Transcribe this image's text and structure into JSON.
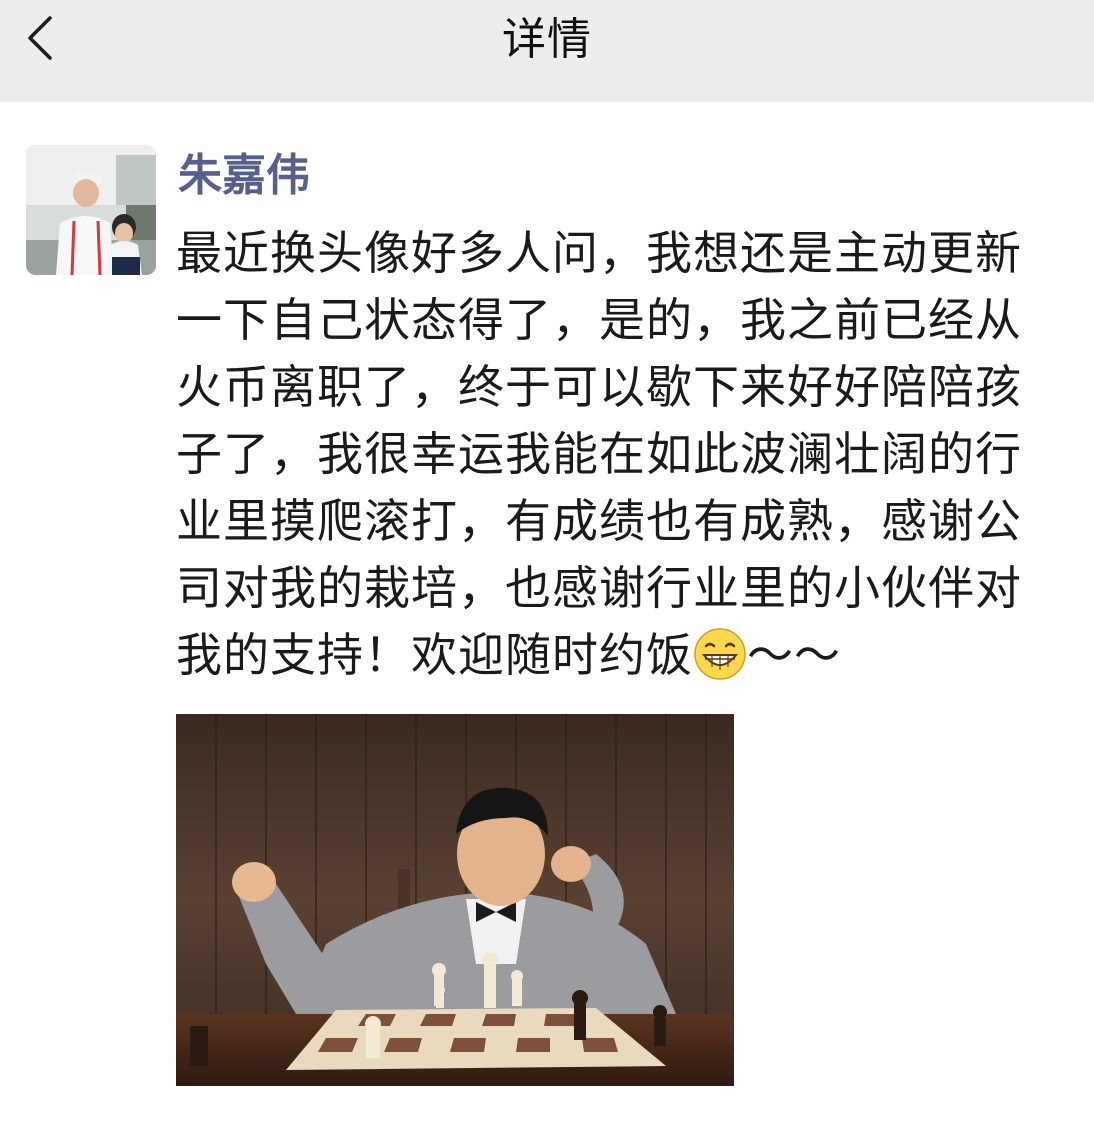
{
  "header": {
    "title": "详情",
    "back_icon": "chevron-left-icon"
  },
  "post": {
    "author": "朱嘉伟",
    "text": "最近换头像好多人问，我想还是主动更新一下自己状态得了，是的，我之前已经从火币离职了，终于可以歇下来好好陪陪孩子了，我很幸运我能在如此波澜壮阔的行业里摸爬滚打，有成绩也有成熟，感谢公司对我的栽培，也感谢行业里的小伙伴对我的支持！欢迎随时约饭",
    "emoji": "grin-emoji",
    "text_suffix": "～～"
  },
  "colors": {
    "nav_bg": "#ededed",
    "author_color": "#56608a",
    "text_color": "#1a1a1a"
  }
}
